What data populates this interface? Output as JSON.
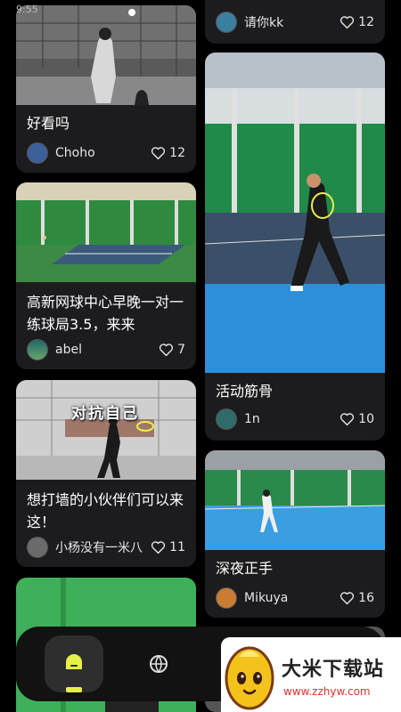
{
  "status": {
    "time": "9:55"
  },
  "left_column": [
    {
      "title": "好看吗",
      "author": "Choho",
      "likes": "12"
    },
    {
      "title": "高新网球中心早晚一对一练球局3.5，来来",
      "author": "abel",
      "likes": "7"
    },
    {
      "title": "想打墙的小伙伴们可以来这！",
      "author": "小杨没有一米八",
      "likes": "11",
      "overlay_caption": "对抗自己"
    },
    {
      "title": "",
      "author": "",
      "likes": ""
    }
  ],
  "right_column": [
    {
      "title": "",
      "author": "请你kk",
      "likes": "12"
    },
    {
      "title": "活动筋骨",
      "author": "1n",
      "likes": "10"
    },
    {
      "title": "深夜正手",
      "author": "Mikuya",
      "likes": "16"
    }
  ],
  "bottom_nav": {
    "active": "home",
    "items": [
      "home-icon",
      "globe-icon"
    ]
  },
  "watermark": {
    "title": "大米下载站",
    "url": "www.zzhyw.com"
  },
  "colors": {
    "card": "#1c1c1e",
    "nav": "#121212",
    "accent": "#e7f04a"
  }
}
